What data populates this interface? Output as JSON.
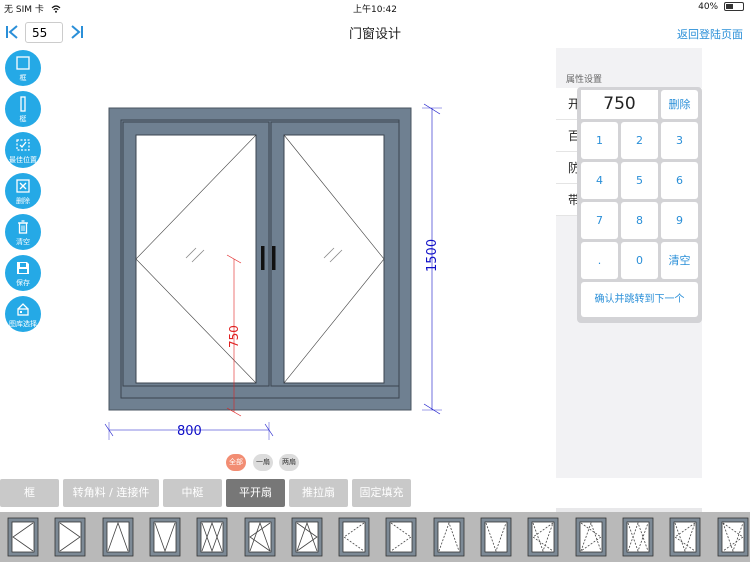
{
  "status_bar": {
    "carrier": "无 SIM 卡",
    "time": "上午10:42",
    "battery": "40%"
  },
  "navbar": {
    "page_number": "55",
    "title": "门窗设计",
    "back_label": "返回登陆页面"
  },
  "tools": [
    {
      "label": "框",
      "icon": "frame-icon"
    },
    {
      "label": "梃",
      "icon": "mullion-icon"
    },
    {
      "label": "最佳位置",
      "icon": "best-position-icon"
    },
    {
      "label": "删除",
      "icon": "delete-icon"
    },
    {
      "label": "清空",
      "icon": "trash-icon"
    },
    {
      "label": "保存",
      "icon": "save-icon"
    },
    {
      "label": "图库选择",
      "icon": "gallery-icon"
    }
  ],
  "drawing": {
    "width_dim": "800",
    "height_dim": "1500",
    "sash_height_dim": "750",
    "frame_color": "#6f8091",
    "dim_color": "#1010c8",
    "sash_dim_color": "#e02020"
  },
  "properties": {
    "title": "属性设置",
    "rows": [
      "开",
      "百",
      "防",
      "带"
    ]
  },
  "keypad": {
    "display": "750",
    "delete_label": "删除",
    "keys": [
      "1",
      "2",
      "3",
      "4",
      "5",
      "6",
      "7",
      "8",
      "9",
      ".",
      "0"
    ],
    "clear_label": "清空",
    "confirm_label": "确认并跳转到下一个"
  },
  "filters": [
    {
      "label": "全部",
      "active": true
    },
    {
      "label": "一扇",
      "active": false
    },
    {
      "label": "两扇",
      "active": false
    }
  ],
  "tabs": [
    {
      "label": "框",
      "active": false
    },
    {
      "label": "转角料 / 连接件",
      "active": false
    },
    {
      "label": "中梃",
      "active": false
    },
    {
      "label": "平开扇",
      "active": true
    },
    {
      "label": "推拉扇",
      "active": false
    },
    {
      "label": "固定填充",
      "active": false
    }
  ],
  "accent_color": "#25a9e6",
  "link_color": "#2a8fd8",
  "thumbnail_count": 16
}
